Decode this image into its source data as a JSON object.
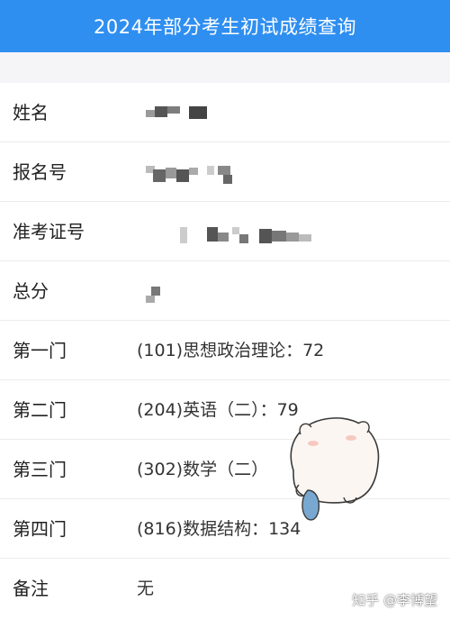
{
  "header": {
    "title": "2024年部分考生初试成绩查询"
  },
  "rows": [
    {
      "label": "姓名",
      "value": ""
    },
    {
      "label": "报名号",
      "value": ""
    },
    {
      "label": "准考证号",
      "value": ""
    },
    {
      "label": "总分",
      "value": ""
    },
    {
      "label": "第一门",
      "value": "(101)思想政治理论：72"
    },
    {
      "label": "第二门",
      "value": "(204)英语（二）：79"
    },
    {
      "label": "第三门",
      "value": "(302)数学（二）"
    },
    {
      "label": "第四门",
      "value": "(816)数据结构：134"
    },
    {
      "label": "备注",
      "value": "无"
    }
  ],
  "watermark": "知乎 @李博望",
  "colors": {
    "header_bg": "#2f8ff0",
    "divider": "#ececec"
  }
}
